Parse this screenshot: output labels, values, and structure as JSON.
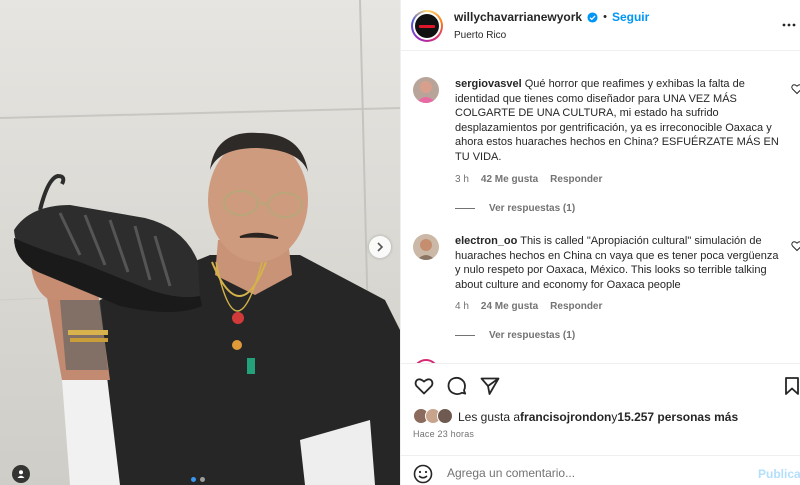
{
  "header": {
    "username": "willychavarrianewyork",
    "separator": "•",
    "follow_label": "Seguir",
    "location": "Puerto Rico",
    "verified_icon": "verified-badge-icon",
    "more_icon": "more-options-icon"
  },
  "media": {
    "next_icon": "chevron-right-icon",
    "tag_icon": "user-tag-icon",
    "carousel_count": 2,
    "carousel_index": 1
  },
  "comments": [
    {
      "username": "sergiovasvel",
      "text": "Qué horror que reafimes y exhibas la falta de identidad que tienes como diseñador para UNA VEZ MÁS COLGARTE DE UNA CULTURA, mi estado ha sufrido desplazamientos por gentrificación, ya es irreconocible Oaxaca y ahora estos huaraches hechos en China? ESFUÉRZATE MÁS EN TU VIDA.",
      "time": "3 h",
      "likes": "42 Me gusta",
      "reply_label": "Responder",
      "view_replies": "Ver respuestas (1)"
    },
    {
      "username": "electron_oo",
      "text": "This is called \"Apropiación cultural\" simulación de huaraches hechos en China cn vaya que es tener poca vergüenza y nulo respeto por Oaxaca, México. This looks so terrible talking about culture and economy for Oaxaca people",
      "time": "4 h",
      "likes": "24 Me gusta",
      "reply_label": "Responder",
      "view_replies": "Ver respuestas (1)"
    }
  ],
  "actions": {
    "like_icon": "heart-icon",
    "comment_icon": "comment-icon",
    "share_icon": "share-icon",
    "save_icon": "bookmark-icon"
  },
  "likes": {
    "prefix": "Les gusta a ",
    "liker": "francisojrondon",
    "middle": " y ",
    "others": "15.257 personas más"
  },
  "time_ago": "Hace 23 horas",
  "comment_box": {
    "emoji_icon": "emoji-icon",
    "placeholder": "Agrega un comentario...",
    "publish_label": "Publicar"
  },
  "colors": {
    "accent": "#0095f6",
    "publish_disabled": "#b2dffc",
    "text": "#262626",
    "secondary": "#737373",
    "active_dot": "#3897f0"
  }
}
